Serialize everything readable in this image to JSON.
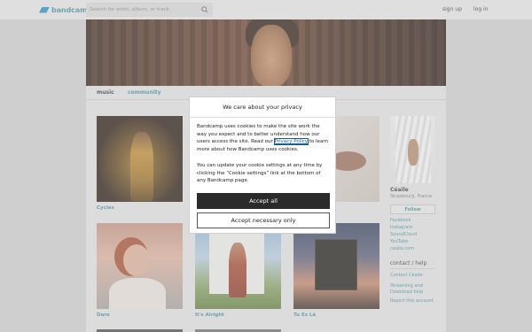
{
  "brand": {
    "name": "bandcamp",
    "color": "#408ea3"
  },
  "topbar": {
    "search_placeholder": "Search for artist, album, or track",
    "signup_label": "sign up",
    "login_label": "log in"
  },
  "tabs": {
    "music": "music",
    "community": "community"
  },
  "albums": [
    {
      "title": "Cycles"
    },
    {
      "title": "Dare"
    },
    {
      "title": "It's Alright"
    },
    {
      "title": "Tu Es Là"
    }
  ],
  "artist": {
    "name": "Céaile",
    "location": "Strasbourg, France",
    "follow_label": "Follow",
    "links": [
      "Facebook",
      "Instagram",
      "SoundCloud",
      "YouTube",
      "ceaile.com"
    ],
    "contact_heading": "contact / help",
    "contact_links": [
      "Contact Céaile",
      "Streaming and Download help",
      "Report this account"
    ]
  },
  "modal": {
    "title": "We care about your privacy",
    "p1_before": "Bandcamp uses cookies to make the site work the way you expect and to better understand how our users access the site. Read our ",
    "p1_link": "Privacy Policy",
    "p1_after": " to learn more about how Bandcamp uses cookies.",
    "p2": "You can update your cookie settings at any time by clicking the “Cookie settings” link at the bottom of any Bandcamp page.",
    "accept_all": "Accept all",
    "accept_necessary": "Accept necessary only"
  }
}
